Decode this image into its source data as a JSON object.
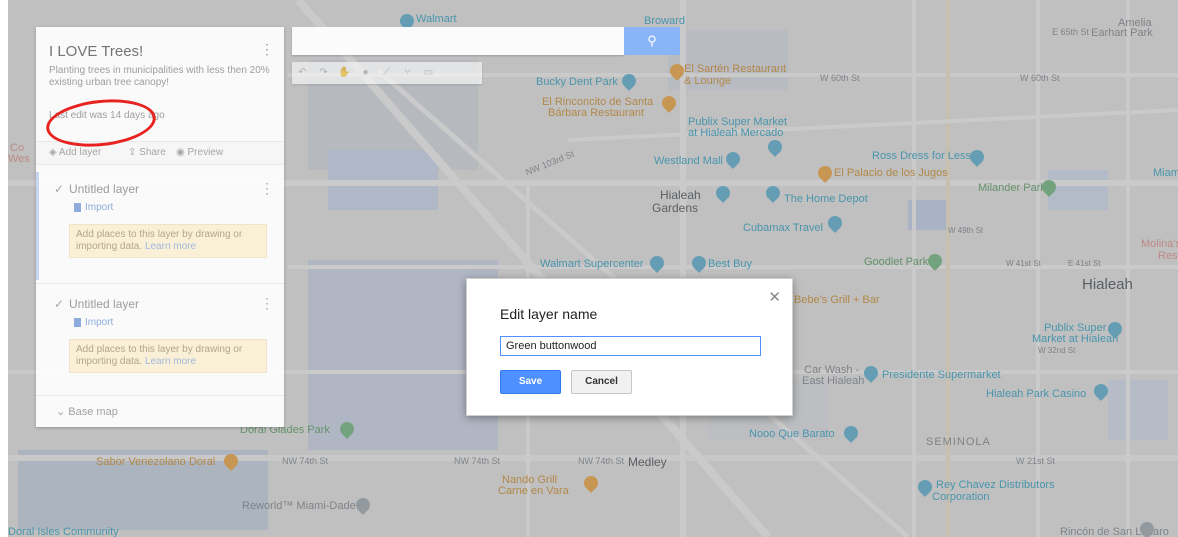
{
  "panel": {
    "title": "I LOVE Trees!",
    "description": "Planting trees in municipalities with less then 20% existing urban tree canopy!",
    "last_edit": "Last edit was 14 days ago",
    "toolbar": {
      "add_layer": "Add layer",
      "share": "Share",
      "preview": "Preview"
    },
    "layers": [
      {
        "name": "Untitled layer",
        "import_label": "Import",
        "hint": "Add places to this layer by drawing or importing data.",
        "learn_more": "Learn more"
      },
      {
        "name": "Untitled layer",
        "import_label": "Import",
        "hint": "Add places to this layer by drawing or importing data.",
        "learn_more": "Learn more"
      }
    ],
    "base_map": "Base map"
  },
  "dialog": {
    "title": "Edit layer name",
    "input_value": "Green buttonwood",
    "save_label": "Save",
    "cancel_label": "Cancel"
  },
  "map": {
    "labels": [
      "Walmart",
      "Broward",
      "Amelia",
      "E 65th St",
      "Earhart Park",
      "Bucky Dent Park",
      "El Sartén Restaurant",
      "& Lounge",
      "W 60th St",
      "W 60th St",
      "El Rinconcito de Santa",
      "Bárbara Restaurant",
      "Publix Super Market",
      "at Hialeah Mercado",
      "NW 103rd St",
      "Westland Mall",
      "Ross Dress for Less",
      "El Palacio de los Jugos",
      "Miami",
      "Hialeah",
      "Gardens",
      "The Home Depot",
      "Milander Park",
      "Cubamax Travel",
      "W 49th St",
      "Molina's R",
      "Resta",
      "Walmart Supercenter",
      "Best Buy",
      "Goodlet Park",
      "W 41st St",
      "E 41st St",
      "Hialeah",
      "Bebe's Grill + Bar",
      "Publix Super",
      "Market at Hialeah",
      "W 32nd St",
      "Car Wash -",
      "East Hialeah",
      "Presidente Supermarket",
      "Hialeah Park Casino",
      "Doral Glades Park",
      "Nooo Que Barato",
      "SEMINOLA",
      "Sabor Venezolano Doral",
      "NW 74th St",
      "NW 74th St",
      "NW 74th St",
      "Medley",
      "W 21st St",
      "Nando Grill",
      "Carne en Vara",
      "Rey Chavez Distributors",
      "Corporation",
      "Reworld™ Miami-Dade",
      "Doral Isles Community",
      "Rincón de San Lázaro",
      "Co",
      "Wes"
    ]
  }
}
